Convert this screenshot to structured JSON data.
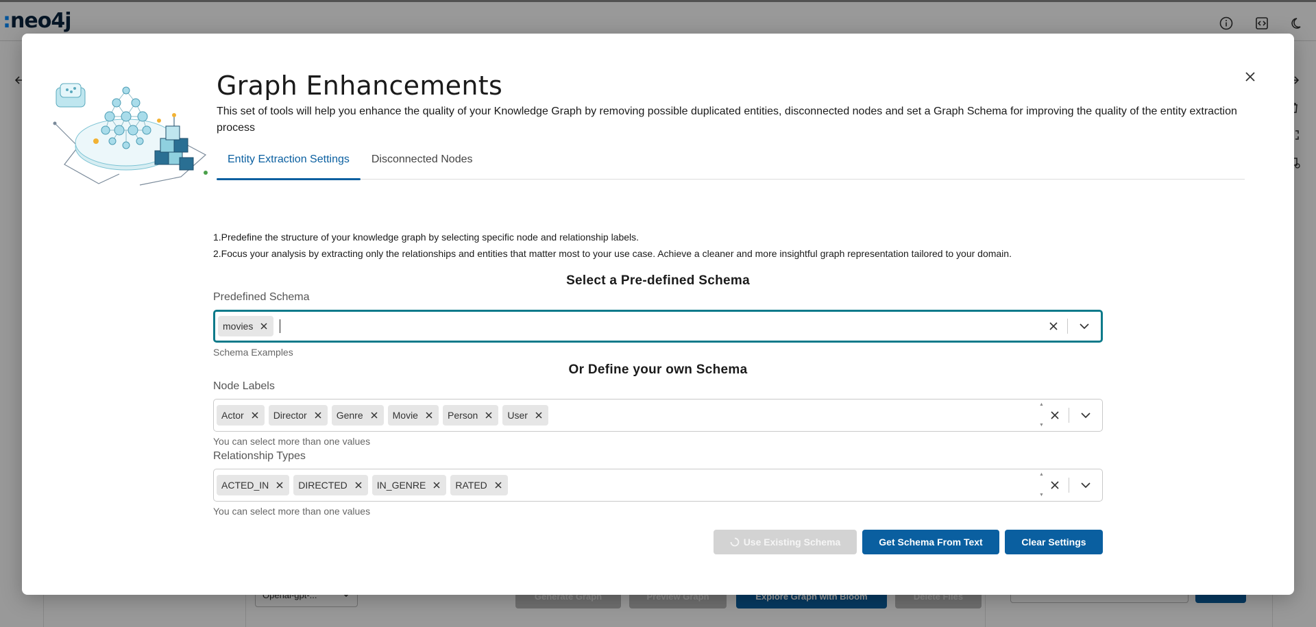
{
  "app": {
    "logo": "neo4j",
    "header_icons": [
      "info-icon",
      "code-icon",
      "moon-icon"
    ]
  },
  "background": {
    "model_select": "Openai-gpt-...",
    "buttons": [
      "Generate Graph",
      "Preview Graph",
      "Explore Graph with Bloom",
      "Delete Files"
    ]
  },
  "modal": {
    "title": "Graph Enhancements",
    "subtitle": "This set of tools will help you enhance the quality of your Knowledge Graph by removing possible duplicated entities, disconnected nodes and set a Graph Schema for improving the quality of the entity extraction process",
    "tabs": [
      {
        "label": "Entity Extraction Settings",
        "active": true
      },
      {
        "label": "Disconnected Nodes",
        "active": false
      }
    ],
    "info_lines": [
      "1.Predefine the structure of your knowledge graph by selecting specific node and relationship labels.",
      "2.Focus your analysis by extracting only the relationships and entities that matter most to your use case. Achieve a cleaner and more insightful graph representation tailored to your domain."
    ],
    "predefined": {
      "section_title": "Select a Pre-defined Schema",
      "label": "Predefined Schema",
      "selected": [
        "movies"
      ],
      "help": "Schema Examples"
    },
    "custom": {
      "section_title": "Or Define your own Schema",
      "node_labels": {
        "label": "Node Labels",
        "values": [
          "Actor",
          "Director",
          "Genre",
          "Movie",
          "Person",
          "User"
        ],
        "help": "You can select more than one values"
      },
      "relationship_types": {
        "label": "Relationship Types",
        "values": [
          "ACTED_IN",
          "DIRECTED",
          "IN_GENRE",
          "RATED"
        ],
        "help": "You can select more than one values"
      }
    },
    "buttons": {
      "use_existing": "Use Existing Schema",
      "from_text": "Get Schema From Text",
      "clear": "Clear Settings"
    },
    "colors": {
      "accent": "#0a5fa0",
      "focus": "#0b7a8a"
    }
  }
}
